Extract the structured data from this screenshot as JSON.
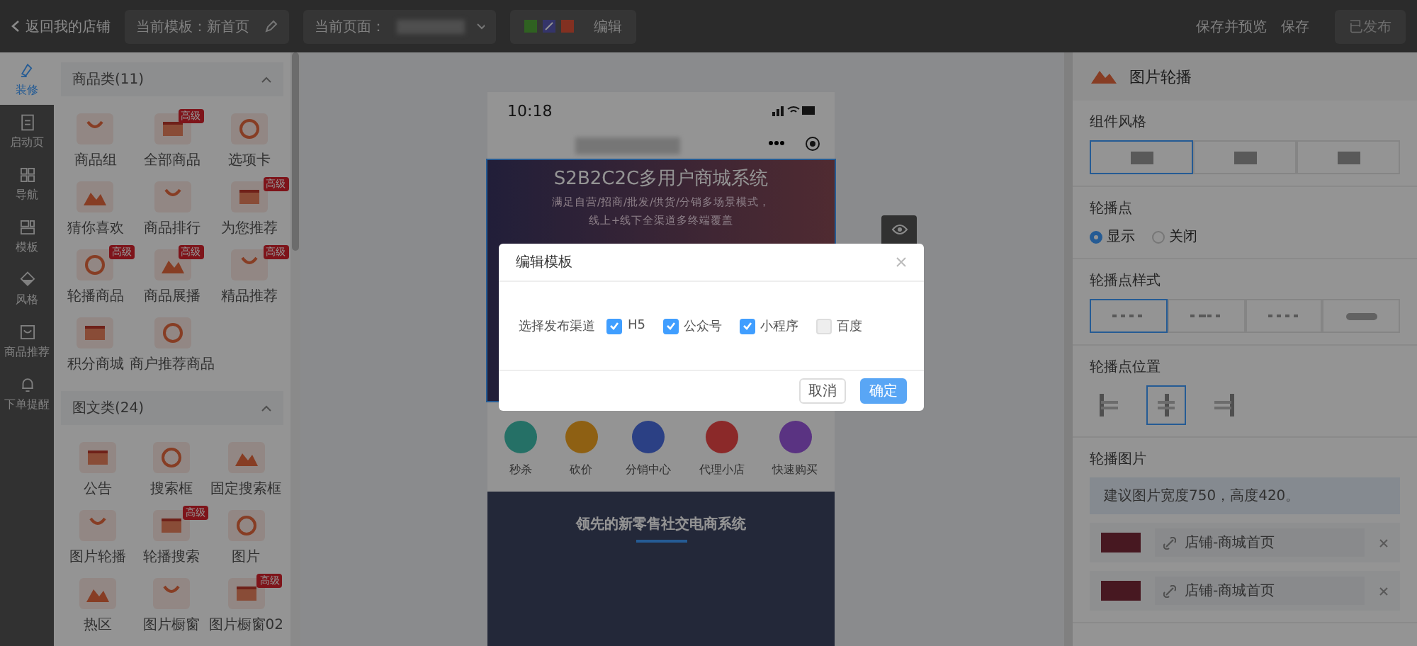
{
  "top_bar": {
    "back_link": "返回我的店铺",
    "template_field": {
      "label": "当前模板：",
      "value": "新首页"
    },
    "page_select": {
      "label": "当前页面："
    },
    "channel_edit": "编辑",
    "save_preview": "保存并预览",
    "save": "保存",
    "publish_button": {
      "label": "已发布",
      "disabled": true
    }
  },
  "nav_rail": [
    {
      "label": "装修",
      "selected": true
    },
    {
      "label": "启动页",
      "selected": false
    },
    {
      "label": "导航",
      "selected": false
    },
    {
      "label": "模板",
      "selected": false
    },
    {
      "label": "风格",
      "selected": false
    },
    {
      "label": "商品推荐",
      "selected": false
    },
    {
      "label": "下单提醒",
      "selected": false
    }
  ],
  "component_groups": [
    {
      "title": "商品类(11)",
      "expanded": true,
      "items": [
        {
          "label": "商品组"
        },
        {
          "label": "全部商品",
          "badge": "高级"
        },
        {
          "label": "选项卡"
        },
        {
          "label": "猜你喜欢"
        },
        {
          "label": "商品排行"
        },
        {
          "label": "为您推荐",
          "badge": "高级"
        },
        {
          "label": "轮播商品",
          "badge": "高级"
        },
        {
          "label": "商品展播",
          "badge": "高级"
        },
        {
          "label": "精品推荐",
          "badge": "高级"
        },
        {
          "label": "积分商城"
        },
        {
          "label": "商户推荐商品"
        }
      ]
    },
    {
      "title": "图文类(24)",
      "expanded": true,
      "items": [
        {
          "label": "公告"
        },
        {
          "label": "搜索框"
        },
        {
          "label": "固定搜索框"
        },
        {
          "label": "图片轮播"
        },
        {
          "label": "轮播搜索",
          "badge": "高级"
        },
        {
          "label": "图片"
        },
        {
          "label": "热区"
        },
        {
          "label": "图片橱窗"
        },
        {
          "label": "图片橱窗02",
          "badge": "高级"
        }
      ]
    }
  ],
  "phone": {
    "status_time": "10:18",
    "banner": {
      "title": "S2B2C2C多用户商城系统",
      "lines": [
        "满足自营/招商/批发/供货/分销多场景模式，",
        "线上+线下全渠道多终端覆盖"
      ]
    },
    "shortcuts": [
      {
        "label": "秒杀",
        "color": "#257066"
      },
      {
        "label": "砍价",
        "color": "#8e6014"
      },
      {
        "label": "分销中心",
        "color": "#2b4084"
      },
      {
        "label": "代理小店",
        "color": "#8b2a2a"
      },
      {
        "label": "快速购买",
        "color": "#5a3382"
      }
    ],
    "promo": {
      "title": "领先的新零售社交电商系统"
    }
  },
  "settings": {
    "title": "图片轮播",
    "sections": [
      {
        "kind": "styles",
        "title": "组件风格",
        "options": [
          {
            "selected": true
          },
          {
            "selected": false
          },
          {
            "selected": false
          }
        ]
      },
      {
        "kind": "radio",
        "title": "轮播点",
        "options": [
          {
            "label": "显示",
            "selected": true
          },
          {
            "label": "关闭",
            "selected": false
          }
        ]
      },
      {
        "kind": "dots",
        "title": "轮播点样式",
        "options": [
          {
            "selected": true
          },
          {
            "selected": false
          },
          {
            "selected": false
          },
          {
            "selected": false
          }
        ]
      },
      {
        "kind": "positions",
        "title": "轮播点位置",
        "options": [
          {
            "selected": false
          },
          {
            "selected": true
          },
          {
            "selected": false
          }
        ]
      },
      {
        "kind": "images",
        "title": "轮播图片",
        "hint": "建议图片宽度750，高度420。",
        "items": [
          {
            "link": "店铺-商城首页"
          },
          {
            "link": "店铺-商城首页"
          }
        ]
      }
    ]
  },
  "modal": {
    "title": "编辑模板",
    "field_label": "选择发布渠道",
    "channels": [
      {
        "label": "H5",
        "checked": true
      },
      {
        "label": "公众号",
        "checked": true
      },
      {
        "label": "小程序",
        "checked": true
      },
      {
        "label": "百度",
        "checked": false
      }
    ],
    "buttons": [
      {
        "label": "取消",
        "kind": "default"
      },
      {
        "label": "确定",
        "kind": "primary"
      }
    ]
  }
}
